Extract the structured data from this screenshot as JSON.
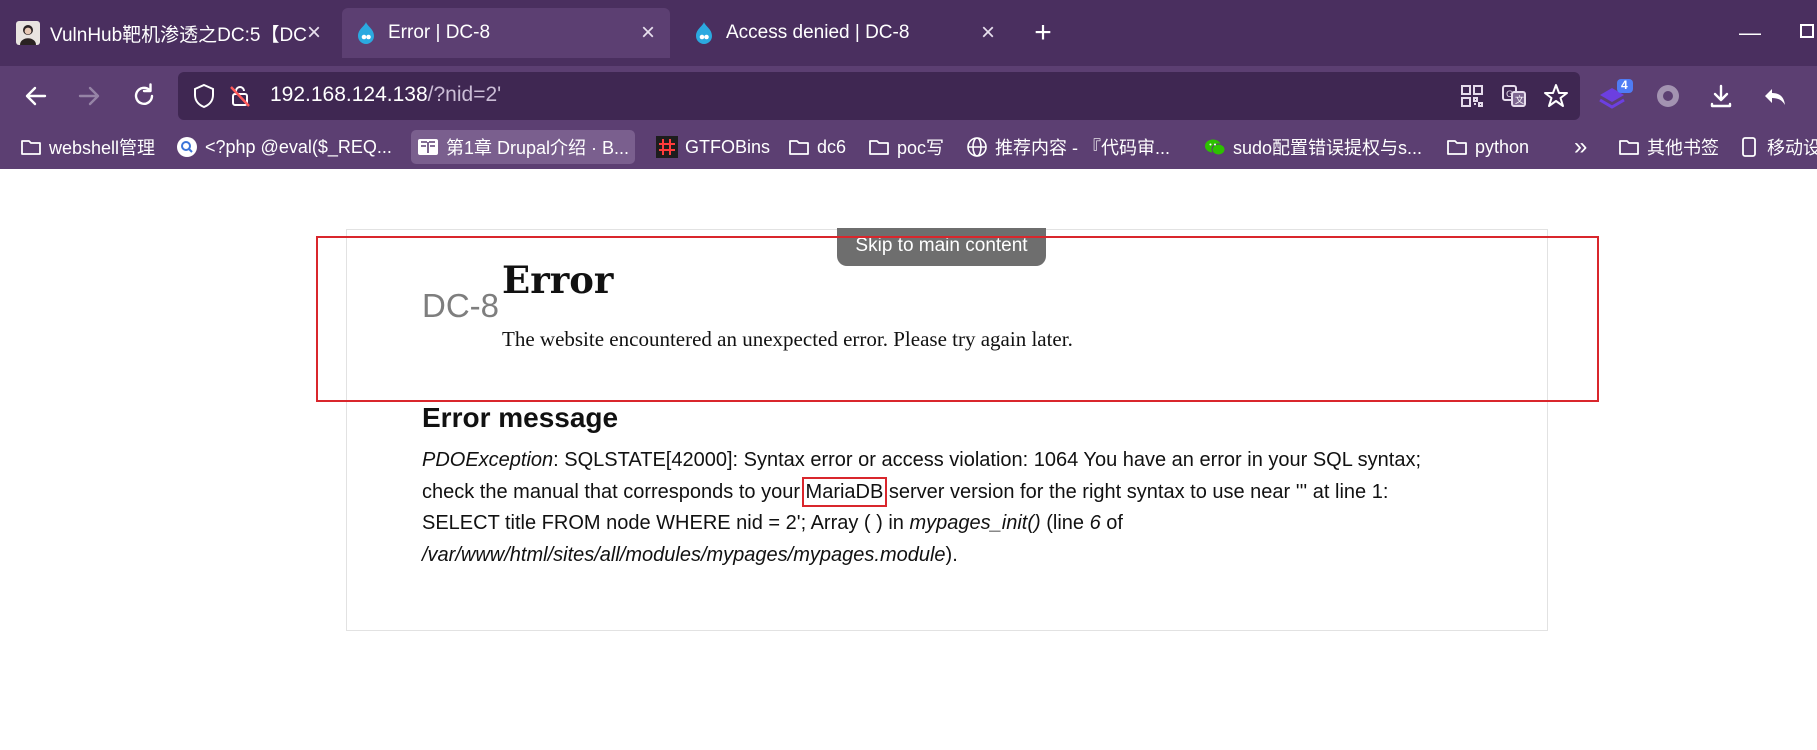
{
  "browser": {
    "tabs": [
      {
        "title": "VulnHub靶机渗透之DC:5【DC"
      },
      {
        "title": "Error | DC-8"
      },
      {
        "title": "Access denied | DC-8"
      }
    ],
    "address": {
      "host": "192.168.124.138",
      "path": "/?nid=2'"
    },
    "extension_badge": "4",
    "bookmarks": [
      "webshell管理",
      "<?php @eval($_REQ...",
      "第1章 Drupal介绍 · B...",
      "GTFOBins",
      "dc6",
      "poc写",
      "推荐内容 - 『代码审...",
      "sudo配置错误提权与s...",
      "python",
      "其他书签",
      "移动设备"
    ],
    "more_bookmarks": "»",
    "icons": {
      "back": "back-arrow-icon",
      "forward": "forward-arrow-icon",
      "reload": "reload-icon",
      "security": "shield-icon",
      "insecure": "not-secure-icon",
      "qr": "qr-code-icon",
      "translate": "translate-icon",
      "bookmark": "star-icon",
      "download": "download-icon",
      "share": "share-arrow-icon",
      "new_tab": "plus-icon",
      "folder": "folder-icon"
    }
  },
  "page": {
    "skip_link": "Skip to main content",
    "site_name": "DC-8",
    "error_title": "Error",
    "error_description": "The website encountered an unexpected error. Please try again later.",
    "message_heading": "Error message",
    "message": {
      "exception": "PDOException",
      "part1": ": SQLSTATE[42000]: Syntax error or access violation: 1064 You have an error in your SQL syntax; check the manual that corresponds to your ",
      "highlight": "MariaDB",
      "part2": " server version for the right syntax to use near ''' at line 1: SELECT title FROM node WHERE nid = 2'; Array ( ) in ",
      "function": "mypages_init()",
      "line_prefix": " (line ",
      "line": "6",
      "of": " of ",
      "path": "/var/www/html/sites/all/modules/mypages/mypages.module",
      "end": ")."
    }
  },
  "colors": {
    "tabstrip": "#4a2f5f",
    "toolbar": "#5c3f72",
    "omnibox": "#3f2752",
    "annotation_red": "#d9262c",
    "skip_link_bg": "#6e6e6e"
  }
}
